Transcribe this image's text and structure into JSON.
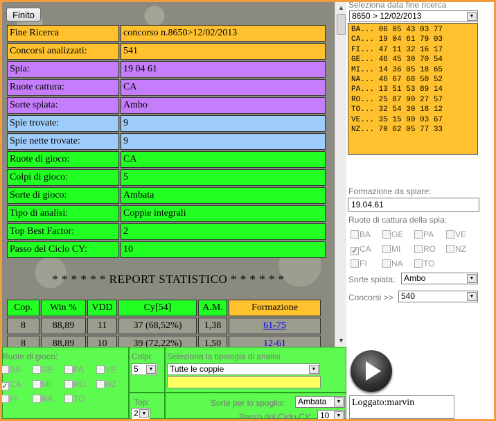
{
  "finito_label": "Finito",
  "info_rows": [
    {
      "key": "Fine Ricerca",
      "value": "concorso n.8650>12/02/2013",
      "color": "yellow"
    },
    {
      "key": "Concorsi analizzati:",
      "value": "541",
      "color": "yellow"
    },
    {
      "key": "Spia:",
      "value": "19 04 61",
      "color": "purple"
    },
    {
      "key": "Ruote cattura:",
      "value": "CA",
      "color": "purple"
    },
    {
      "key": "Sorte spiata:",
      "value": "Ambo",
      "color": "purple"
    },
    {
      "key": "Spie trovate:",
      "value": "9",
      "color": "blue"
    },
    {
      "key": "Spie nette trovate:",
      "value": "9",
      "color": "blue"
    },
    {
      "key": "Ruote di gioco:",
      "value": "CA",
      "color": "green"
    },
    {
      "key": "Colpi di gioco:",
      "value": "5",
      "color": "green"
    },
    {
      "key": "Sorte di gioco:",
      "value": "Ambata",
      "color": "green"
    },
    {
      "key": "Tipo di analisi:",
      "value": "Coppie integrali",
      "color": "green"
    },
    {
      "key": "Top Best Factor:",
      "value": "2",
      "color": "green"
    },
    {
      "key": "Passo del Ciclo CY:",
      "value": "10",
      "color": "green"
    }
  ],
  "report_title": "* * * * * * REPORT STATISTICO * * * * * *",
  "stats_headers": [
    "Cop.",
    "Win %",
    "VDD",
    "Cy[54]",
    "A.M.",
    "Formazione"
  ],
  "stats_rows": [
    [
      "8",
      "88,89",
      "11",
      "37 (68,52%)",
      "1,38",
      "61-75"
    ],
    [
      "8",
      "88,89",
      "10",
      "39 (72,22%)",
      "1,50",
      "12-61"
    ]
  ],
  "right": {
    "data_label": "Seleziona data fine ricerca",
    "data_value": "8650 > 12/02/2013",
    "estrazioni": [
      "BA... 06 05 43 03 77",
      "CA... 19 04 61 79 03",
      "FI... 47 11 32 16 17",
      "GE... 46 45 30 70 54",
      "MI... 14 36 05 18 65",
      "NA... 46 67 68 50 52",
      "PA... 13 51 53 89 14",
      "RO... 25 87 90 27 57",
      "TO... 32 54 30 18 12",
      "VE... 35 15 90 03 67",
      "NZ... 70 62 05 77 33"
    ],
    "formazione_label": "Formazione da spiare:",
    "formazione_value": "19.04.61",
    "ruote_cattura_label": "Ruote di cattura della spia:",
    "ruote": [
      "BA",
      "GE",
      "PA",
      "VE",
      "CA",
      "MI",
      "RO",
      "NZ",
      "FI",
      "NA",
      "TO"
    ],
    "ruote_checked": [
      "CA"
    ],
    "sorte_label": "Sorte spiata:",
    "sorte_value": "Ambo",
    "concorsi_label": "Concorsi >>",
    "concorsi_value": "540"
  },
  "bottom": {
    "ruote_gioco_label": "Ruote di gioco:",
    "ruote_checked": [
      "CA"
    ],
    "colpi_label": "Colpi:",
    "colpi_value": "5",
    "tipologia_label": "Seleziona la tipologia di analisi",
    "tipologia_value": "Tutte le coppie",
    "top_label": "Top:",
    "top_value": "2",
    "sorte_spoglio_label": "Sorte per lo spoglio:",
    "sorte_spoglio_value": "Ambata",
    "passo_label": "Passo del Ciclo CY:",
    "passo_value": "10"
  },
  "logged": "Loggato:marvin"
}
